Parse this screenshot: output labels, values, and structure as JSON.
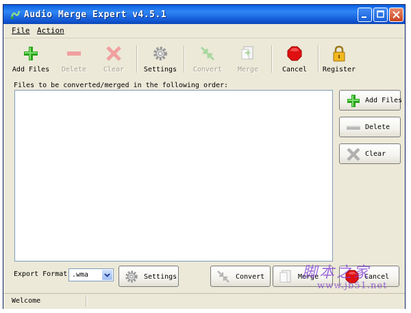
{
  "window": {
    "title": "Audio Merge Expert v4.5.1"
  },
  "menu": {
    "file": "File",
    "action": "Action"
  },
  "toolbar": {
    "add_files": "Add Files",
    "delete": "Delete",
    "clear": "Clear",
    "settings": "Settings",
    "convert": "Convert",
    "merge": "Merge",
    "cancel": "Cancel",
    "register": "Register"
  },
  "main": {
    "files_label": "Files to be converted/merged in the following order:",
    "side_buttons": {
      "add_files": "Add Files",
      "delete": "Delete",
      "clear": "Clear"
    }
  },
  "export": {
    "label": "Export Format",
    "format_value": ".wma"
  },
  "bottom_buttons": {
    "settings": "Settings",
    "convert": "Convert",
    "merge": "Merge",
    "cancel": "Cancel"
  },
  "status": {
    "text": "Welcome"
  },
  "watermark": {
    "line1": "脚本之家",
    "line2": "www.jb51.net"
  },
  "colors": {
    "titlebar": "#1459d6",
    "window_bg": "#ece9d8",
    "add_green": "#2aa31c",
    "cancel_red": "#e01010",
    "disabled_gray": "#a6a294"
  }
}
